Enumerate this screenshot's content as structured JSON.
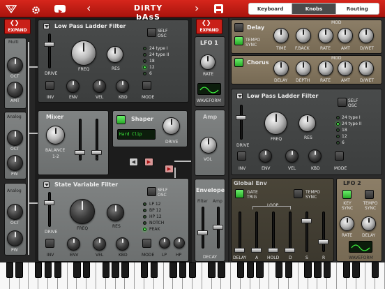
{
  "header": {
    "title": "DiRTY bAsS",
    "tabs": [
      "Keyboard",
      "Knobs",
      "Routing"
    ],
    "active_tab": "Knobs"
  },
  "left_strip": {
    "expand": "EXPAND",
    "sections": [
      "Multi",
      "Analog",
      "Analog"
    ],
    "labels": [
      "OCT",
      "AMT",
      "OCT",
      "PW",
      "OCT",
      "PW"
    ]
  },
  "lpf1": {
    "title": "Low Pass Ladder Filter",
    "self_osc": "SELF OSC",
    "knobs": [
      "FREQ",
      "RES"
    ],
    "drive": "DRIVE",
    "bottom": [
      "INV",
      "ENV",
      "VEL",
      "KBD",
      "MODE"
    ],
    "modes": [
      "24 type I",
      "24 type II",
      "18",
      "12",
      "6"
    ]
  },
  "mixer": {
    "title": "Mixer",
    "balance": "BALANCE",
    "range": "1-2",
    "faders": [
      "1",
      "2"
    ]
  },
  "shaper": {
    "title": "Shaper",
    "mode": "Hard Clip",
    "drive": "DRIVE"
  },
  "svf": {
    "title": "State Variable Filter",
    "self_osc": "SELF OSC",
    "knobs": [
      "FREQ",
      "RES"
    ],
    "drive": "DRIVE",
    "bottom": [
      "INV",
      "ENV",
      "VEL",
      "KBD",
      "MODE",
      "LP",
      "HP"
    ],
    "modes": [
      "LP 12",
      "BP 12",
      "HP 12",
      "NOTCH",
      "PEAK"
    ]
  },
  "lfo1": {
    "expand": "EXPAND",
    "title": "LFO 1",
    "rate": "RATE",
    "waveform": "WAVEFORM",
    "amp": "Amp",
    "vol": "VOL"
  },
  "envelope": {
    "title": "Envelope",
    "filter": "Filter",
    "amp": "Amp",
    "decay": "DECAY"
  },
  "delay": {
    "title": "Delay",
    "sync": "TEMPO SYNC",
    "knobs": [
      "TIME",
      "F.BACK",
      "RATE",
      "AMT",
      "D/WET"
    ],
    "mod": "MOD"
  },
  "chorus": {
    "title": "Chorus",
    "knobs": [
      "DELAY",
      "DEPTH",
      "RATE",
      "AMT",
      "D/WET"
    ],
    "mod": "MOD"
  },
  "lpf2": {
    "title": "Low Pass Ladder Filter",
    "self_osc": "SELF OSC",
    "knobs": [
      "FREQ",
      "RES"
    ],
    "drive": "DRIVE",
    "bottom": [
      "INV",
      "ENV",
      "VEL",
      "KBD",
      "MODE"
    ],
    "modes": [
      "24 type I",
      "24 type II",
      "18",
      "12",
      "6"
    ]
  },
  "global_env": {
    "title": "Global Env",
    "gate": "GATE TRIG",
    "sync": "TEMPO SYNC",
    "loop": "LOOP",
    "faders": [
      "DELAY",
      "A",
      "HOLD",
      "D",
      "S",
      "R"
    ]
  },
  "lfo2": {
    "title": "LFO 2",
    "key_sync": "KEY SYNC",
    "tempo_sync": "TEMPO SYNC",
    "knobs": [
      "RATE",
      "DELAY"
    ],
    "waveform": "WAVEFORM"
  },
  "colors": {
    "accent": "#c92018",
    "led": "#47f047"
  }
}
